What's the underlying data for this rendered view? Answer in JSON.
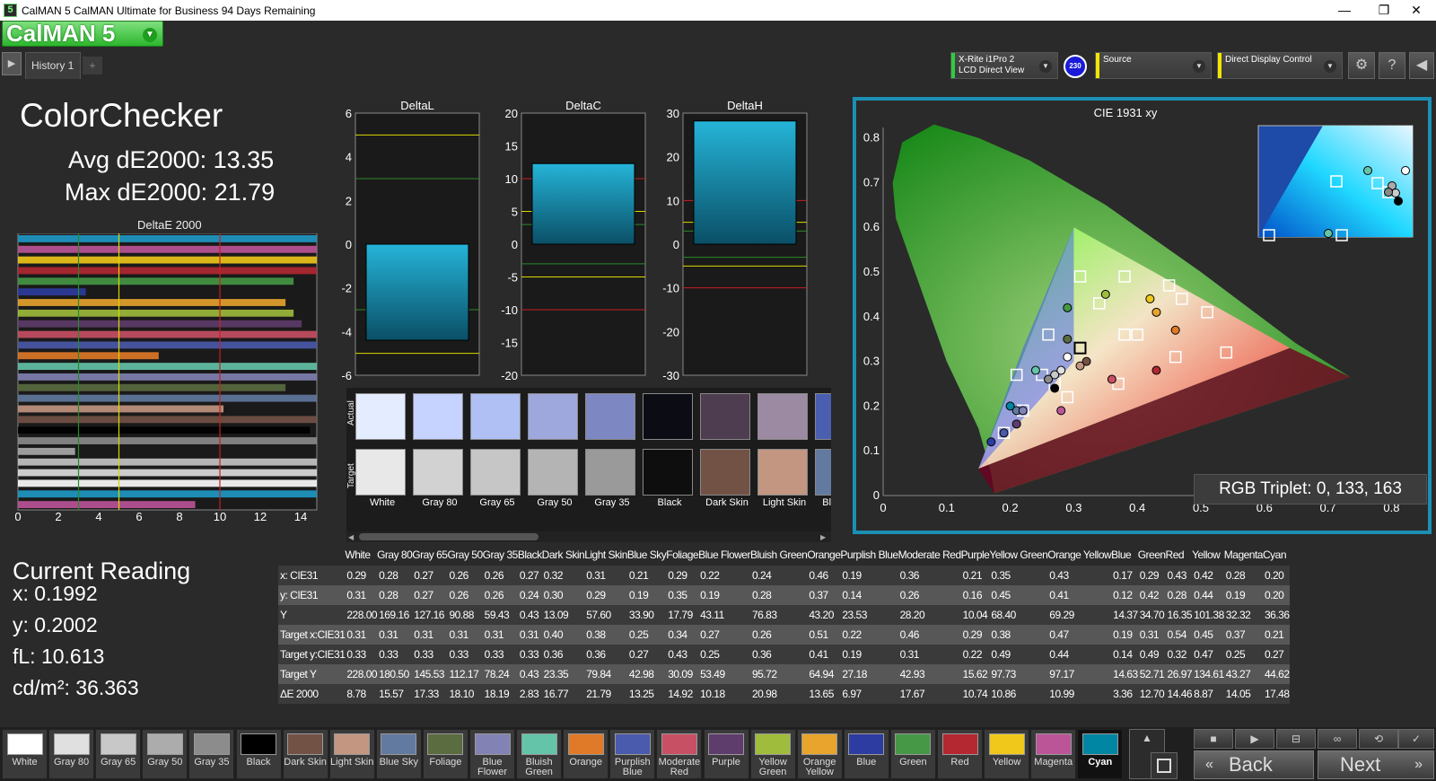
{
  "window": {
    "title": "CalMAN 5 CalMAN Ultimate for Business 94 Days Remaining",
    "app_icon": "5",
    "minimize": "—",
    "maximize": "❐",
    "close": "✕"
  },
  "logo": {
    "text": "CalMAN 5"
  },
  "history_tab": {
    "label": "History 1",
    "add": "+"
  },
  "devices": {
    "meter": {
      "line1": "X-Rite i1Pro 2",
      "line2": "LCD Direct View",
      "badge": "230",
      "accent": "#2ecc40"
    },
    "source": {
      "label": "Source",
      "accent": "#f2e600"
    },
    "display": {
      "label": "Direct Display Control",
      "accent": "#f2e600"
    }
  },
  "toolbar_icons": [
    "gear-icon",
    "help-icon",
    "collapse-icon"
  ],
  "heading": {
    "title": "ColorChecker",
    "avg": "Avg dE2000: 13.35",
    "max": "Max dE2000: 21.79"
  },
  "deltae_chart": {
    "title": "DeltaE 2000",
    "ticks": [
      "0",
      "2",
      "4",
      "6",
      "8",
      "10",
      "12",
      "14"
    ]
  },
  "delta_charts": [
    {
      "title": "DeltaL",
      "ticks": [
        "6",
        "4",
        "2",
        "0",
        "-2",
        "-4",
        "-6"
      ]
    },
    {
      "title": "DeltaC",
      "ticks": [
        "20",
        "15",
        "10",
        "5",
        "0",
        "-5",
        "-10",
        "-15",
        "-20"
      ]
    },
    {
      "title": "DeltaH",
      "ticks": [
        "30",
        "20",
        "10",
        "0",
        "-10",
        "-20",
        "-30"
      ]
    }
  ],
  "swatch_panel": {
    "actual": "Actual",
    "target": "Target"
  },
  "swatches": [
    {
      "name": "White",
      "actual": "#e4ecff",
      "target": "#e8e8e8"
    },
    {
      "name": "Gray 80",
      "actual": "#c6d2ff",
      "target": "#d2d2d2"
    },
    {
      "name": "Gray 65",
      "actual": "#b0c0f4",
      "target": "#c6c6c6"
    },
    {
      "name": "Gray 50",
      "actual": "#9ea8dc",
      "target": "#b4b4b4"
    },
    {
      "name": "Gray 35",
      "actual": "#7d88c2",
      "target": "#9a9a9a"
    },
    {
      "name": "Black",
      "actual": "#0c0c14",
      "target": "#0e0e0e"
    },
    {
      "name": "Dark Skin",
      "actual": "#4e3c50",
      "target": "#735246"
    },
    {
      "name": "Light Skin",
      "actual": "#9c8aa2",
      "target": "#c39682"
    },
    {
      "name": "Blue Sky",
      "actual": "#4a5fb0",
      "target": "#627aa0"
    }
  ],
  "cie": {
    "title": "CIE 1931 xy",
    "xticks": [
      "0",
      "0.1",
      "0.2",
      "0.3",
      "0.4",
      "0.5",
      "0.6",
      "0.7",
      "0.8"
    ],
    "yticks": [
      "0.8",
      "0.7",
      "0.6",
      "0.5",
      "0.4",
      "0.3",
      "0.2",
      "0.1",
      "0"
    ],
    "rgb_triplet": "RGB Triplet: 0, 133, 163"
  },
  "current_reading": {
    "title": "Current Reading",
    "x": "x: 0.1992",
    "y": "y: 0.2002",
    "fl": "fL: 10.613",
    "cdm2": "cd/m²: 36.363"
  },
  "table": {
    "headers": [
      "White",
      "Gray 80",
      "Gray 65",
      "Gray 50",
      "Gray 35",
      "Black",
      "Dark Skin",
      "Light Skin",
      "Blue Sky",
      "Foliage",
      "Blue Flower",
      "Bluish Green",
      "Orange",
      "Purplish Blue",
      "Moderate Red",
      "Purple",
      "Yellow Green",
      "Orange Yellow",
      "Blue",
      "Green",
      "Red",
      "Yellow",
      "Magenta",
      "Cyan"
    ],
    "rows": [
      {
        "label": "x: CIE31",
        "values": [
          "0.29",
          "0.28",
          "0.27",
          "0.26",
          "0.26",
          "0.27",
          "0.32",
          "0.31",
          "0.21",
          "0.29",
          "0.22",
          "0.24",
          "0.46",
          "0.19",
          "0.36",
          "0.21",
          "0.35",
          "0.43",
          "0.17",
          "0.29",
          "0.43",
          "0.42",
          "0.28",
          "0.20"
        ]
      },
      {
        "label": "y: CIE31",
        "values": [
          "0.31",
          "0.28",
          "0.27",
          "0.26",
          "0.26",
          "0.24",
          "0.30",
          "0.29",
          "0.19",
          "0.35",
          "0.19",
          "0.28",
          "0.37",
          "0.14",
          "0.26",
          "0.16",
          "0.45",
          "0.41",
          "0.12",
          "0.42",
          "0.28",
          "0.44",
          "0.19",
          "0.20"
        ]
      },
      {
        "label": "Y",
        "values": [
          "228.00",
          "169.16",
          "127.16",
          "90.88",
          "59.43",
          "0.43",
          "13.09",
          "57.60",
          "33.90",
          "17.79",
          "43.11",
          "76.83",
          "43.20",
          "23.53",
          "28.20",
          "10.04",
          "68.40",
          "69.29",
          "14.37",
          "34.70",
          "16.35",
          "101.38",
          "32.32",
          "36.36"
        ]
      },
      {
        "label": "Target x:CIE31",
        "values": [
          "0.31",
          "0.31",
          "0.31",
          "0.31",
          "0.31",
          "0.31",
          "0.40",
          "0.38",
          "0.25",
          "0.34",
          "0.27",
          "0.26",
          "0.51",
          "0.22",
          "0.46",
          "0.29",
          "0.38",
          "0.47",
          "0.19",
          "0.31",
          "0.54",
          "0.45",
          "0.37",
          "0.21"
        ]
      },
      {
        "label": "Target y:CIE31",
        "values": [
          "0.33",
          "0.33",
          "0.33",
          "0.33",
          "0.33",
          "0.33",
          "0.36",
          "0.36",
          "0.27",
          "0.43",
          "0.25",
          "0.36",
          "0.41",
          "0.19",
          "0.31",
          "0.22",
          "0.49",
          "0.44",
          "0.14",
          "0.49",
          "0.32",
          "0.47",
          "0.25",
          "0.27"
        ]
      },
      {
        "label": "Target Y",
        "values": [
          "228.00",
          "180.50",
          "145.53",
          "112.17",
          "78.24",
          "0.43",
          "23.35",
          "79.84",
          "42.98",
          "30.09",
          "53.49",
          "95.72",
          "64.94",
          "27.18",
          "42.93",
          "15.62",
          "97.73",
          "97.17",
          "14.63",
          "52.71",
          "26.97",
          "134.61",
          "43.27",
          "44.62"
        ]
      },
      {
        "label": "ΔE 2000",
        "values": [
          "8.78",
          "15.57",
          "17.33",
          "18.10",
          "18.19",
          "2.83",
          "16.77",
          "21.79",
          "13.25",
          "14.92",
          "10.18",
          "20.98",
          "13.65",
          "6.97",
          "17.67",
          "10.74",
          "10.86",
          "10.99",
          "3.36",
          "12.70",
          "14.46",
          "8.87",
          "14.05",
          "17.48"
        ]
      }
    ]
  },
  "bottom_tiles": [
    {
      "label": "White",
      "color": "#ffffff"
    },
    {
      "label": "Gray 80",
      "color": "#e0e0e0"
    },
    {
      "label": "Gray 65",
      "color": "#c8c8c8"
    },
    {
      "label": "Gray 50",
      "color": "#acacac"
    },
    {
      "label": "Gray 35",
      "color": "#8c8c8c"
    },
    {
      "label": "Black",
      "color": "#000000"
    },
    {
      "label": "Dark Skin",
      "color": "#735246"
    },
    {
      "label": "Light Skin",
      "color": "#c39682"
    },
    {
      "label": "Blue Sky",
      "color": "#627aa0"
    },
    {
      "label": "Foliage",
      "color": "#5a6c40"
    },
    {
      "label": "Blue Flower",
      "color": "#8282b4"
    },
    {
      "label": "Bluish Green",
      "color": "#64c4aa"
    },
    {
      "label": "Orange",
      "color": "#e07a28"
    },
    {
      "label": "Purplish Blue",
      "color": "#4a5aac"
    },
    {
      "label": "Moderate Red",
      "color": "#c85064"
    },
    {
      "label": "Purple",
      "color": "#5e3c6c"
    },
    {
      "label": "Yellow Green",
      "color": "#a0bc3c"
    },
    {
      "label": "Orange Yellow",
      "color": "#e8a42c"
    },
    {
      "label": "Blue",
      "color": "#2c3ca0"
    },
    {
      "label": "Green",
      "color": "#469846"
    },
    {
      "label": "Red",
      "color": "#b42832"
    },
    {
      "label": "Yellow",
      "color": "#f0c81c"
    },
    {
      "label": "Magenta",
      "color": "#bc5498"
    },
    {
      "label": "Cyan",
      "color": "#0085a3"
    }
  ],
  "nav": {
    "back": "Back",
    "next": "Next"
  },
  "deltae_values": [
    21.79,
    14.92,
    18.1,
    16.77,
    13.65,
    3.36,
    13.25,
    13.65,
    14.05,
    17.48,
    21.79,
    6.97,
    17.67,
    20.98,
    13.25,
    16.77,
    10.18,
    17.33,
    14.46,
    18.19,
    2.83,
    18.19,
    18.1,
    17.33,
    15.57,
    8.78
  ],
  "deltae_colors": [
    "#1e9ac8",
    "#bc5498",
    "#f0c81c",
    "#b42832",
    "#469846",
    "#2c3ca0",
    "#e8a42c",
    "#a0bc3c",
    "#5e3c6c",
    "#c85064",
    "#4a5aac",
    "#e07a28",
    "#64c4aa",
    "#8282b4",
    "#5a6c40",
    "#627aa0",
    "#c39682",
    "#735246",
    "#000000",
    "#8c8c8c",
    "#acacac",
    "#c8c8c8",
    "#e0e0e0",
    "#ffffff"
  ],
  "deltaL": {
    "bar": [
      0,
      -4.4
    ]
  },
  "deltaC": {
    "bar": [
      12.3,
      0
    ]
  },
  "deltaH": {
    "bar": [
      28.2,
      0
    ]
  }
}
